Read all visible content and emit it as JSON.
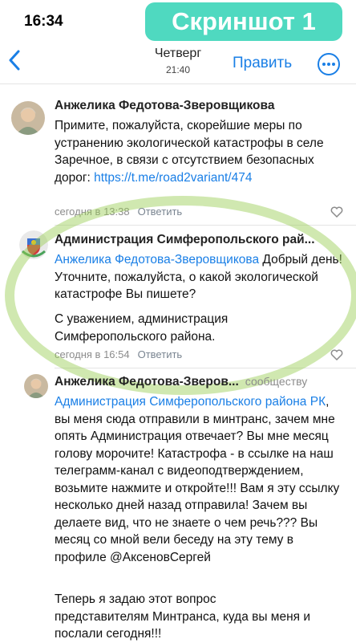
{
  "status_bar": {
    "time": "16:34"
  },
  "overlay_badge": "Скриншот 1",
  "nav": {
    "back_icon": "chevron-left-icon",
    "title": "Четверг",
    "subtitle": "21:40",
    "edit_label": "Править",
    "more_icon": "ellipsis-circle-icon"
  },
  "comments": [
    {
      "author": "Анжелика Федотова-Зверовщикова",
      "text": "Примите, пожалуйста, скорейшие меры по устранению экологической катастрофы в селе Заречное, в связи с отсутствием безопасных дорог: ",
      "link": "https://t.me/road2variant/474",
      "time": "сегодня в 13:38",
      "reply_label": "Ответить"
    },
    {
      "author": "Администрация Симферопольского рай...",
      "mention": "Анжелика Федотова-Зверовщикова",
      "text": " Добрый день! Уточните, пожалуйста, о какой экологической катастрофе Вы пишете?",
      "text2": "С уважением, администрация Симферопольского района.",
      "time": "сегодня в 16:54",
      "reply_label": "Ответить"
    },
    {
      "author": "Анжелика Федотова-Зверов...",
      "community_label": "сообществу",
      "mention": "Администрация Симферопольского района РК",
      "text": ", вы меня сюда отправили в минтранс, зачем мне опять Администрация отвечает? Вы мне месяц голову морочите! Катастрофа - в ссылке на наш телеграмм-канал с видеоподтверждением, возьмите нажмите и откройте!!! Вам я эту ссылку несколько дней назад отправила! Зачем вы делаете вид, что не знаете о чем речь??? Вы месяц со мной вели беседу на эту тему в профиле @АксеновСергей",
      "text2": "Теперь я задаю этот вопрос представителям Минтранса, куда вы меня и послали сегодня!!!"
    }
  ]
}
